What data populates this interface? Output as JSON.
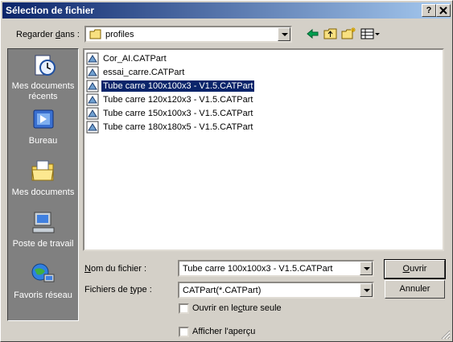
{
  "window": {
    "title": "Sélection de fichier",
    "help_btn": "?",
    "close_btn": "X"
  },
  "lookin": {
    "label_pre": "Regarder ",
    "label_u": "d",
    "label_post": "ans :",
    "value": "profiles"
  },
  "places": [
    {
      "label": "Mes documents récents"
    },
    {
      "label": "Bureau"
    },
    {
      "label": "Mes documents"
    },
    {
      "label": "Poste de travail"
    },
    {
      "label": "Favoris réseau"
    }
  ],
  "files": [
    {
      "name": "Cor_AI.CATPart",
      "selected": false
    },
    {
      "name": "essai_carre.CATPart",
      "selected": false
    },
    {
      "name": "Tube carre 100x100x3 - V1.5.CATPart",
      "selected": true
    },
    {
      "name": "Tube carre 120x120x3 - V1.5.CATPart",
      "selected": false
    },
    {
      "name": "Tube carre 150x100x3 - V1.5.CATPart",
      "selected": false
    },
    {
      "name": "Tube carre 180x180x5 - V1.5.CATPart",
      "selected": false
    }
  ],
  "filename": {
    "label_u": "N",
    "label_post": "om du fichier :",
    "value": "Tube carre 100x100x3 - V1.5.CATPart"
  },
  "filetype": {
    "label_pre": "Fichiers de ",
    "label_u": "t",
    "label_post": "ype :",
    "value": "CATPart(*.CATPart)"
  },
  "readonly": {
    "label_pre": "Ouvrir en le",
    "label_u": "c",
    "label_post": "ture seule",
    "checked": false
  },
  "preview": {
    "label": "Afficher l'aperçu",
    "checked": false
  },
  "buttons": {
    "open_u": "O",
    "open_post": "uvrir",
    "cancel": "Annuler"
  },
  "colors": {
    "title_start": "#0a246a",
    "title_end": "#a6caf0",
    "selection": "#0a246a",
    "places_bg": "#808080"
  }
}
